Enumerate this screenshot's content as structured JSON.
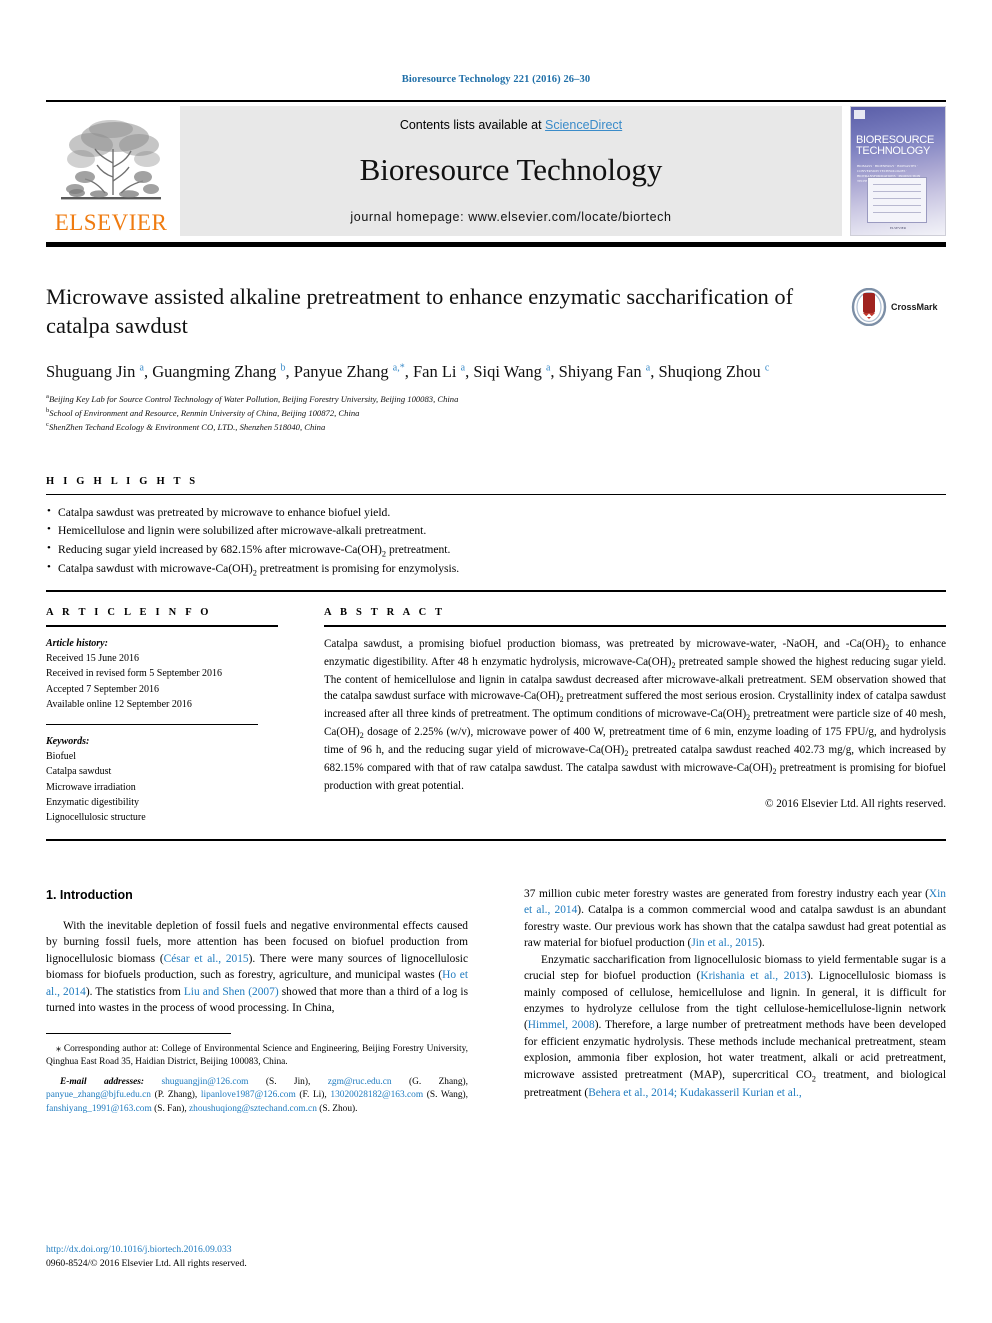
{
  "running_head": "Bioresource Technology 221 (2016) 26–30",
  "masthead": {
    "contents_prefix": "Contents lists available at ",
    "sciencedirect": "ScienceDirect",
    "journal_title": "Bioresource Technology",
    "homepage": "journal homepage: www.elsevier.com/locate/biortech",
    "publisher_logo_text": "ELSEVIER",
    "cover": {
      "line1": "BIORESOURCE",
      "line2": "TECHNOLOGY",
      "subtitle": "BIOMASS · BIOENERGY · BIOWASTES · CONVERSION TECHNOLOGIES · BIOTRANSFORMATIONS · PRODUCTION TECHNOLOGIES",
      "footer": "ELSEVIER"
    },
    "accent_color": "#3a8bc9",
    "elsevier_orange": "#ef7b10"
  },
  "article": {
    "title": "Microwave assisted alkaline pretreatment to enhance enzymatic saccharification of catalpa sawdust",
    "crossmark_label": "CrossMark",
    "authors_html": "Shuguang Jin <sup>a</sup>, Guangming Zhang <sup>b</sup>, Panyue Zhang <sup>a,*</sup>, Fan Li <sup>a</sup>, Siqi Wang <sup>a</sup>, Shiyang Fan <sup>a</sup>, Shuqiong Zhou <sup>c</sup>",
    "affiliations": [
      "Beijing Key Lab for Source Control Technology of Water Pollution, Beijing Forestry University, Beijing 100083, China",
      "School of Environment and Resource, Renmin University of China, Beijing 100872, China",
      "ShenZhen Techand Ecology & Environment CO, LTD., Shenzhen 518040, China"
    ],
    "affiliation_marks": [
      "a",
      "b",
      "c"
    ]
  },
  "highlights": {
    "heading": "H I G H L I G H T S",
    "items_html": [
      "Catalpa sawdust was pretreated by microwave to enhance biofuel yield.",
      "Hemicellulose and lignin were solubilized after microwave-alkali pretreatment.",
      "Reducing sugar yield increased by 682.15% after microwave-Ca(OH)<sub>2</sub> pretreatment.",
      "Catalpa sawdust with microwave-Ca(OH)<sub>2</sub> pretreatment is promising for enzymolysis."
    ]
  },
  "article_info": {
    "heading": "A R T I C L E   I N F O",
    "history_label": "Article history:",
    "history": [
      "Received 15 June 2016",
      "Received in revised form 5 September 2016",
      "Accepted 7 September 2016",
      "Available online 12 September 2016"
    ],
    "keywords_label": "Keywords:",
    "keywords": [
      "Biofuel",
      "Catalpa sawdust",
      "Microwave irradiation",
      "Enzymatic digestibility",
      "Lignocellulosic structure"
    ]
  },
  "abstract": {
    "heading": "A B S T R A C T",
    "text_html": "Catalpa sawdust, a promising biofuel production biomass, was pretreated by microwave-water, -NaOH, and -Ca(OH)<sub>2</sub> to enhance enzymatic digestibility. After 48 h enzymatic hydrolysis, microwave-Ca(OH)<sub>2</sub> pretreated sample showed the highest reducing sugar yield. The content of hemicellulose and lignin in catalpa sawdust decreased after microwave-alkali pretreatment. SEM observation showed that the catalpa sawdust surface with microwave-Ca(OH)<sub>2</sub> pretreatment suffered the most serious erosion. Crystallinity index of catalpa sawdust increased after all three kinds of pretreatment. The optimum conditions of microwave-Ca(OH)<sub>2</sub> pretreatment were particle size of 40 mesh, Ca(OH)<sub>2</sub> dosage of 2.25% (w/v), microwave power of 400 W, pretreatment time of 6 min, enzyme loading of 175 FPU/g, and hydrolysis time of 96 h, and the reducing sugar yield of microwave-Ca(OH)<sub>2</sub> pretreated catalpa sawdust reached 402.73 mg/g, which increased by 682.15% compared with that of raw catalpa sawdust. The catalpa sawdust with microwave-Ca(OH)<sub>2</sub> pretreatment is promising for biofuel production with great potential.",
    "copyright": "© 2016 Elsevier Ltd. All rights reserved."
  },
  "body": {
    "section_heading": "1. Introduction",
    "left_para1_html": "With the inevitable depletion of fossil fuels and negative environmental effects caused by burning fossil fuels, more attention has been focused on biofuel production from lignocellulosic biomass (<span class=\"ref\">César et al., 2015</span>). There were many sources of lignocellulosic biomass for biofuels production, such as forestry, agriculture, and municipal wastes (<span class=\"ref\">Ho et al., 2014</span>). The statistics from <span class=\"ref\">Liu and Shen (2007)</span> showed that more than a third of a log is turned into wastes in the process of wood processing. In China,",
    "right_para1_html": "37 million cubic meter forestry wastes are generated from forestry industry each year (<span class=\"ref\">Xin et al., 2014</span>). Catalpa is a common commercial wood and catalpa sawdust is an abundant forestry waste. Our previous work has shown that the catalpa sawdust had great potential as raw material for biofuel production (<span class=\"ref\">Jin et al., 2015</span>).",
    "right_para2_html": "Enzymatic saccharification from lignocellulosic biomass to yield fermentable sugar is a crucial step for biofuel production (<span class=\"ref\">Krishania et al., 2013</span>). Lignocellulosic biomass is mainly composed of cellulose, hemicellulose and lignin. In general, it is difficult for enzymes to hydrolyze cellulose from the tight cellulose-hemicellulose-lignin network (<span class=\"ref\">Himmel, 2008</span>). Therefore, a large number of pretreatment methods have been developed for efficient enzymatic hydrolysis. These methods include mechanical pretreatment, steam explosion, ammonia fiber explosion, hot water treatment, alkali or acid pretreatment, microwave assisted pretreatment (MAP), supercritical CO<sub>2</sub> treatment, and biological pretreatment (<span class=\"ref\">Behera et al., 2014; Kudakasseril Kurian et al.,</span>"
  },
  "footnote": {
    "corresponding_html": "<span class=\"star\">⁎</span> Corresponding author at: College of Environmental Science and Engineering, Beijing Forestry University, Qinghua East Road 35, Haidian District, Beijing 100083, China.",
    "email_label": "E-mail addresses:",
    "emails_html": "<span class=\"ref\">shuguangjin@126.com</span> (S. Jin), <span class=\"ref\">zgm@ruc.edu.cn</span> (G. Zhang), <span class=\"ref\">panyue_zhang@bjfu.edu.cn</span> (P. Zhang), <span class=\"ref\">lipanlove1987@126.com</span> (F. Li), <span class=\"ref\">13020028182@163.com</span> (S. Wang), <span class=\"ref\">fanshiyang_1991@163.com</span> (S. Fan), <span class=\"ref\">zhoushuqiong@sztechand.com.cn</span> (S. Zhou)."
  },
  "footer": {
    "doi": "http://dx.doi.org/10.1016/j.biortech.2016.09.033",
    "issn_line": "0960-8524/© 2016 Elsevier Ltd. All rights reserved."
  }
}
